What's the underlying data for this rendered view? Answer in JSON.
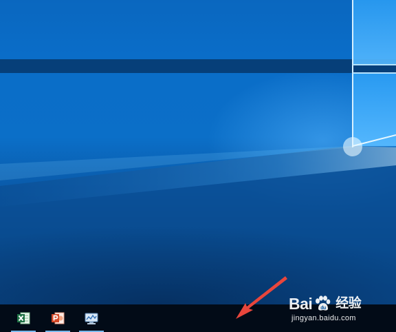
{
  "taskbar": {
    "pinned_apps": [
      {
        "name": "Microsoft Excel",
        "icon": "excel-icon",
        "color": "#1e7145",
        "active": true
      },
      {
        "name": "Microsoft PowerPoint",
        "icon": "powerpoint-icon",
        "color": "#d24726",
        "active": true
      },
      {
        "name": "Remote Desktop / Monitor",
        "icon": "monitor-app-icon",
        "color": "#4a8fd1",
        "active": true
      }
    ],
    "indicator_color": "#76b9ed",
    "background_color": "#020b17"
  },
  "desktop": {
    "wallpaper": "windows-10-hero-light-window",
    "accent_color": "#0a6dc8"
  },
  "annotation": {
    "type": "red-arrow",
    "color": "#e8463c"
  },
  "watermark": {
    "brand_prefix": "Bai",
    "brand_suffix": "经验",
    "domain": "jingyan.baidu.com"
  }
}
